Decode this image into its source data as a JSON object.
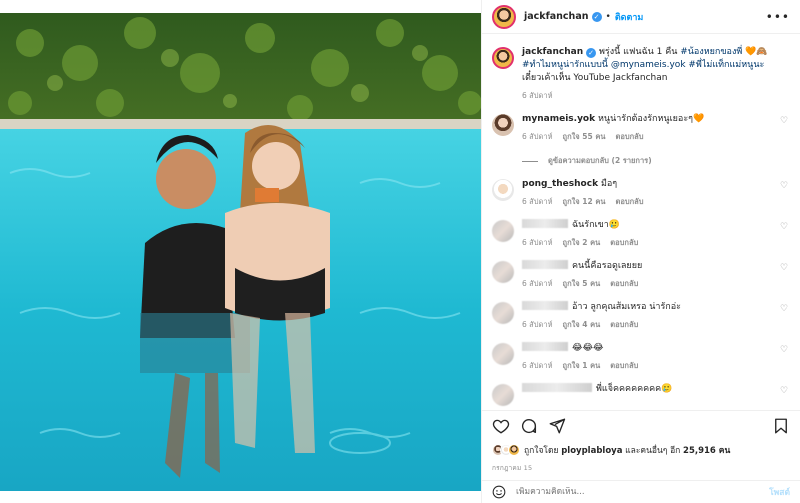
{
  "header": {
    "username": "jackfanchan",
    "separator": "•",
    "follow_label": "ติดตาม",
    "more_label": "•••"
  },
  "caption": {
    "username": "jackfanchan",
    "text_plain": " พรุ่งนี้ แฟนฉัน 1 คืน ",
    "tag1": "#น้องหยกของพี่",
    "emoji1": " 🧡🙈 ",
    "tag2": "#ทำไมหนูน่ารักแบบนี้",
    "mention": " @mynameis.yok ",
    "tag3": "#พี่ไม่แท็กแม่หนูนะ",
    "text_tail": " เดี๋ยวเค้าเห็น YouTube Jackfanchan",
    "time": "6 สัปดาห์"
  },
  "comments": [
    {
      "username": "mynameis.yok",
      "text": "หนูน่ารักต้องรักหนูเยอะๆ🧡",
      "time": "6 สัปดาห์",
      "likes": "ถูกใจ 55 คน",
      "reply": "ตอบกลับ",
      "view_replies": "ดูข้อความตอบกลับ (2 รายการ)"
    },
    {
      "username": "pong_theshock",
      "text": "มือๆ",
      "time": "6 สัปดาห์",
      "likes": "ถูกใจ 12 คน",
      "reply": "ตอบกลับ"
    },
    {
      "username": "",
      "text": "ฉันรักเขา🥲",
      "time": "6 สัปดาห์",
      "likes": "ถูกใจ 2 คน",
      "reply": "ตอบกลับ"
    },
    {
      "username": "",
      "text": "คนนี้คือรอดูเลยยย",
      "time": "6 สัปดาห์",
      "likes": "ถูกใจ 5 คน",
      "reply": "ตอบกลับ"
    },
    {
      "username": "",
      "text": "อ้าว ลูกคุณส้มเหรอ น่ารักอ่ะ",
      "time": "6 สัปดาห์",
      "likes": "ถูกใจ 4 คน",
      "reply": "ตอบกลับ"
    },
    {
      "username": "",
      "text": "😂😂😂",
      "time": "6 สัปดาห์",
      "likes": "ถูกใจ 1 คน",
      "reply": "ตอบกลับ"
    },
    {
      "username": "",
      "text": "พี่แจ็คคคคคคคค🥲",
      "time": "",
      "likes": "",
      "reply": ""
    }
  ],
  "likes": {
    "prefix": "ถูกใจโดย ",
    "user": "ployplabloya",
    "middle": " และคนอื่นๆ อีก ",
    "count": "25,916",
    "suffix": " คน"
  },
  "date": "กรกฎาคม 15",
  "add_comment": {
    "placeholder": "เพิ่มความคิดเห็น...",
    "post_label": "โพสต์"
  },
  "icons": {
    "verified": "verified-badge-icon",
    "like": "heart-icon",
    "comment": "comment-bubble-icon",
    "share": "paper-plane-icon",
    "save": "bookmark-icon",
    "emoji": "smiley-icon"
  },
  "colors": {
    "accent": "#0095f6",
    "verified": "#3897f0",
    "muted": "#8e8e8e",
    "pool": "#1fb6cf"
  }
}
